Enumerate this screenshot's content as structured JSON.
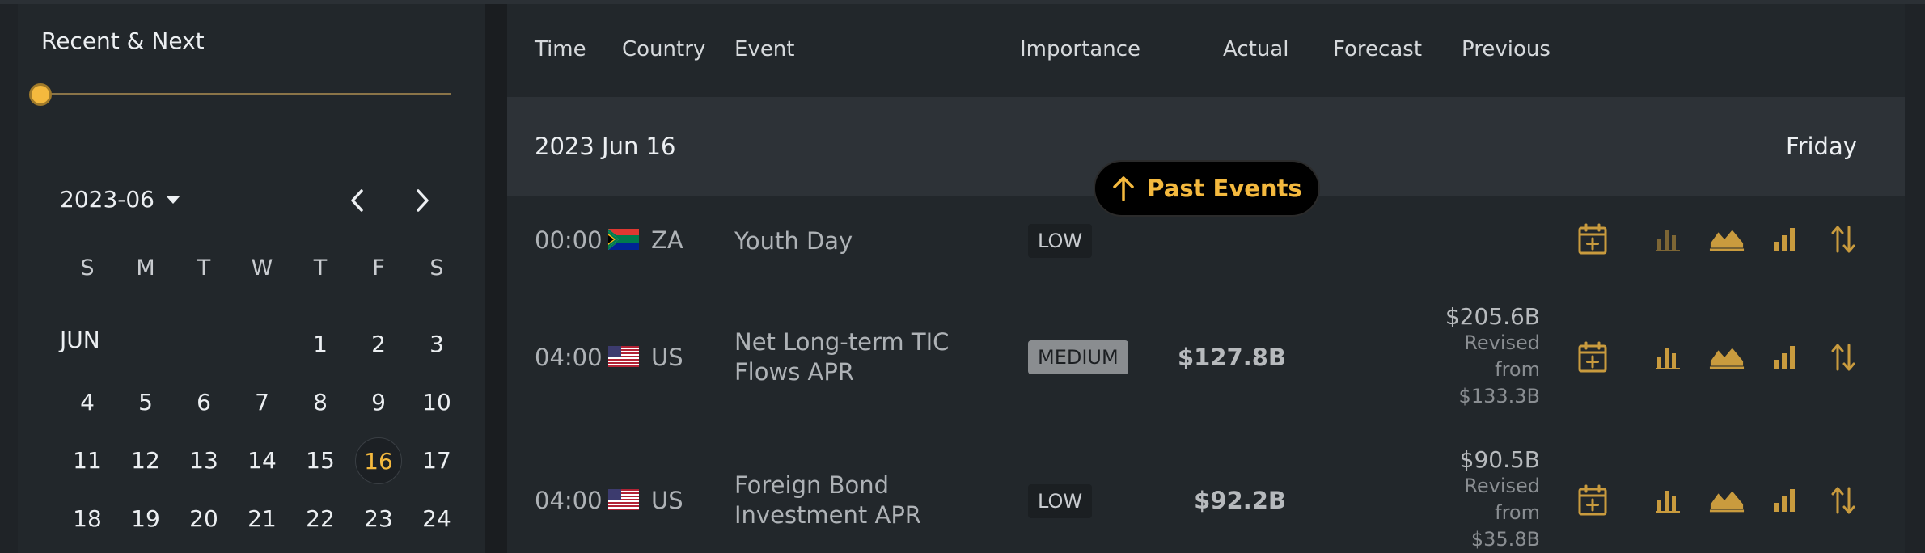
{
  "sidebar": {
    "title": "Recent & Next",
    "month_selector": "2023-06",
    "weekdays": [
      "S",
      "M",
      "T",
      "W",
      "T",
      "F",
      "S"
    ],
    "month_label": "JUN",
    "selected_day": "16",
    "weeks": [
      [
        "",
        "",
        "",
        "",
        "1",
        "2",
        "3"
      ],
      [
        "4",
        "5",
        "6",
        "7",
        "8",
        "9",
        "10"
      ],
      [
        "11",
        "12",
        "13",
        "14",
        "15",
        "16",
        "17"
      ],
      [
        "18",
        "19",
        "20",
        "21",
        "22",
        "23",
        "24"
      ]
    ]
  },
  "table": {
    "headers": {
      "time": "Time",
      "country": "Country",
      "event": "Event",
      "importance": "Importance",
      "actual": "Actual",
      "forecast": "Forecast",
      "previous": "Previous"
    },
    "date_row": {
      "date": "2023 Jun 16",
      "weekday": "Friday"
    },
    "past_events_button": "Past Events",
    "rows": [
      {
        "time": "00:00",
        "country": "ZA",
        "flag": "za-flag",
        "event": "Youth Day",
        "importance": "LOW",
        "actual": "",
        "forecast": "",
        "previous": "",
        "revised_line1": "",
        "revised_line2": "",
        "revised_value": ""
      },
      {
        "time": "04:00",
        "country": "US",
        "flag": "us-flag",
        "event": "Net Long-term TIC Flows APR",
        "importance": "MEDIUM",
        "actual": "$127.8B",
        "forecast": "",
        "previous": "$205.6B",
        "revised_line1": "Revised",
        "revised_line2": "from",
        "revised_value": "$133.3B"
      },
      {
        "time": "04:00",
        "country": "US",
        "flag": "us-flag",
        "event": "Foreign Bond Investment APR",
        "importance": "LOW",
        "actual": "$92.2B",
        "forecast": "",
        "previous": "$90.5B",
        "revised_line1": "Revised",
        "revised_line2": "from",
        "revised_value": "$35.8B"
      }
    ],
    "row_actions": [
      "calendar-add-icon",
      "bar-chart-icon",
      "area-chart-icon",
      "signal-bars-icon",
      "sort-arrows-icon"
    ]
  },
  "colors": {
    "accent": "#f4b93e",
    "icon_gold": "#c99b3e",
    "panel": "#22272b",
    "date_row": "#2d3237"
  }
}
